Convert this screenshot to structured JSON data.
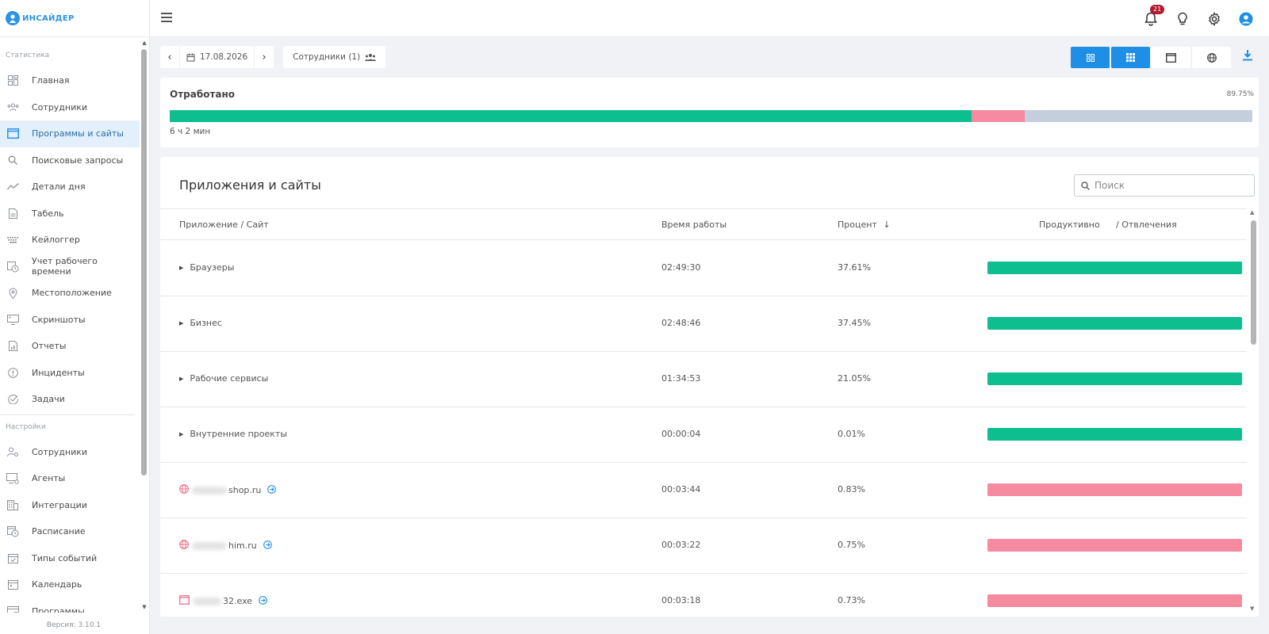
{
  "app": {
    "logo_text": "ИНСАЙДЕР",
    "version": "Версия: 3.10.1",
    "accent": "#1e8ee6"
  },
  "sidebar": {
    "sections": [
      {
        "title": "Статистика"
      },
      {
        "title": "Настройки"
      }
    ],
    "stats_items": [
      {
        "label": "Главная",
        "icon": "dashboard-icon"
      },
      {
        "label": "Сотрудники",
        "icon": "people-icon"
      },
      {
        "label": "Программы и сайты",
        "icon": "window-icon",
        "active": true
      },
      {
        "label": "Поисковые запросы",
        "icon": "search-icon"
      },
      {
        "label": "Детали дня",
        "icon": "trend-icon"
      },
      {
        "label": "Табель",
        "icon": "document-icon"
      },
      {
        "label": "Кейлоггер",
        "icon": "keyboard-icon"
      },
      {
        "label": "Учет рабочего времени",
        "icon": "clock-calendar-icon"
      },
      {
        "label": "Местоположение",
        "icon": "location-pin-icon"
      },
      {
        "label": "Скриншоты",
        "icon": "monitor-icon"
      },
      {
        "label": "Отчеты",
        "icon": "report-icon"
      },
      {
        "label": "Инциденты",
        "icon": "alert-circle-icon"
      },
      {
        "label": "Задачи",
        "icon": "check-circle-icon"
      }
    ],
    "settings_items": [
      {
        "label": "Сотрудники",
        "icon": "user-settings-icon"
      },
      {
        "label": "Агенты",
        "icon": "computer-agent-icon"
      },
      {
        "label": "Интеграции",
        "icon": "building-icon"
      },
      {
        "label": "Расписание",
        "icon": "schedule-icon"
      },
      {
        "label": "Типы событий",
        "icon": "calendar-check-icon"
      },
      {
        "label": "Календарь",
        "icon": "calendar-icon"
      },
      {
        "label": "Программы",
        "icon": "program-window-icon"
      }
    ]
  },
  "topbar": {
    "notification_count": "21",
    "icons": [
      "bell-icon",
      "lightbulb-icon",
      "settings-gear-icon",
      "user-account-icon"
    ]
  },
  "toolbar": {
    "date": "17.08.2026",
    "employees_label": "Сотрудники (1)",
    "view_buttons": [
      "grid-small-icon",
      "grid-large-icon",
      "window-view-icon",
      "globe-icon"
    ]
  },
  "worked": {
    "title": "Отработано",
    "percent": "89.75%",
    "time": "6 ч 2 мин",
    "productive_fraction": 0.7405,
    "distraction_fraction": 0.0495,
    "colors": {
      "productive": "#0dbf8f",
      "distraction": "#f58aa0",
      "rest": "#c5cedd"
    }
  },
  "apps": {
    "title": "Приложения и сайты",
    "search_placeholder": "Поиск",
    "columns": {
      "name": "Приложение / Сайт",
      "time": "Время работы",
      "percent": "Процент",
      "productive": "Продуктивно",
      "distraction": "/ Отвлечения"
    },
    "rows": [
      {
        "type": "group",
        "name": "Браузеры",
        "time": "02:49:30",
        "percent": "37.61%",
        "status": "productive"
      },
      {
        "type": "group",
        "name": "Бизнес",
        "time": "02:48:46",
        "percent": "37.45%",
        "status": "productive"
      },
      {
        "type": "group",
        "name": "Рабочие сервисы",
        "time": "01:34:53",
        "percent": "21.05%",
        "status": "productive"
      },
      {
        "type": "group",
        "name": "Внутренние проекты",
        "time": "00:00:04",
        "percent": "0.01%",
        "status": "productive"
      },
      {
        "type": "site",
        "name": "shop.ru",
        "time": "00:03:44",
        "percent": "0.83%",
        "status": "distraction"
      },
      {
        "type": "site",
        "name": "him.ru",
        "time": "00:03:22",
        "percent": "0.75%",
        "status": "distraction"
      },
      {
        "type": "app",
        "name": "32.exe",
        "time": "00:03:18",
        "percent": "0.73%",
        "status": "distraction"
      }
    ]
  }
}
